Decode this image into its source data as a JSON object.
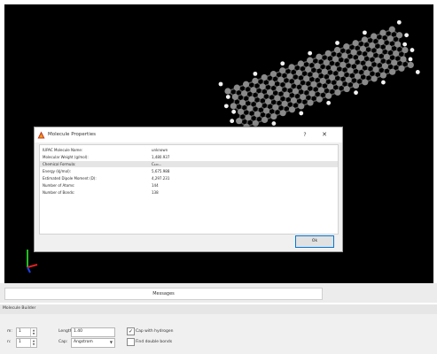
{
  "dialog": {
    "title": "Molecule Properties",
    "help_label": "?",
    "close_label": "✕",
    "ok_label": "Ok",
    "properties": [
      {
        "key": "IUPAC Molecule Name:",
        "value": "unknown"
      },
      {
        "key": "Molecular Weight (g/mol):",
        "value": "1,480.937"
      },
      {
        "key": "Chemical Formula:",
        "value": "C₁₂₀..."
      },
      {
        "key": "Energy (kJ/mol):",
        "value": "5,675.988"
      },
      {
        "key": "Estimated Dipole Moment (D):",
        "value": "4,297.231"
      },
      {
        "key": "Number of Atoms:",
        "value": "144"
      },
      {
        "key": "Number of Bonds:",
        "value": "138"
      }
    ]
  },
  "messages": {
    "label": "Messages"
  },
  "builder": {
    "title": "Molecule Builder",
    "row1": {
      "spin_label": "m:",
      "spin_value": "1",
      "length_label": "Length:",
      "length_value": "1.40",
      "check_label": "Cap with hydrogen",
      "checked": "✓"
    },
    "row2": {
      "spin_label": "n:",
      "spin_value": "1",
      "cap_label": "Cap:",
      "cap_value": "Angstrom",
      "check_label": "Find double bonds",
      "checked": ""
    }
  },
  "colors": {
    "viewport_bg": "#000000",
    "atom_carbon": "#8a8a8a",
    "atom_hydrogen": "#f2f2f2",
    "axis_x": "#e02020",
    "axis_y": "#20c020",
    "axis_z": "#2040e0",
    "ok_border": "#0078d7"
  }
}
